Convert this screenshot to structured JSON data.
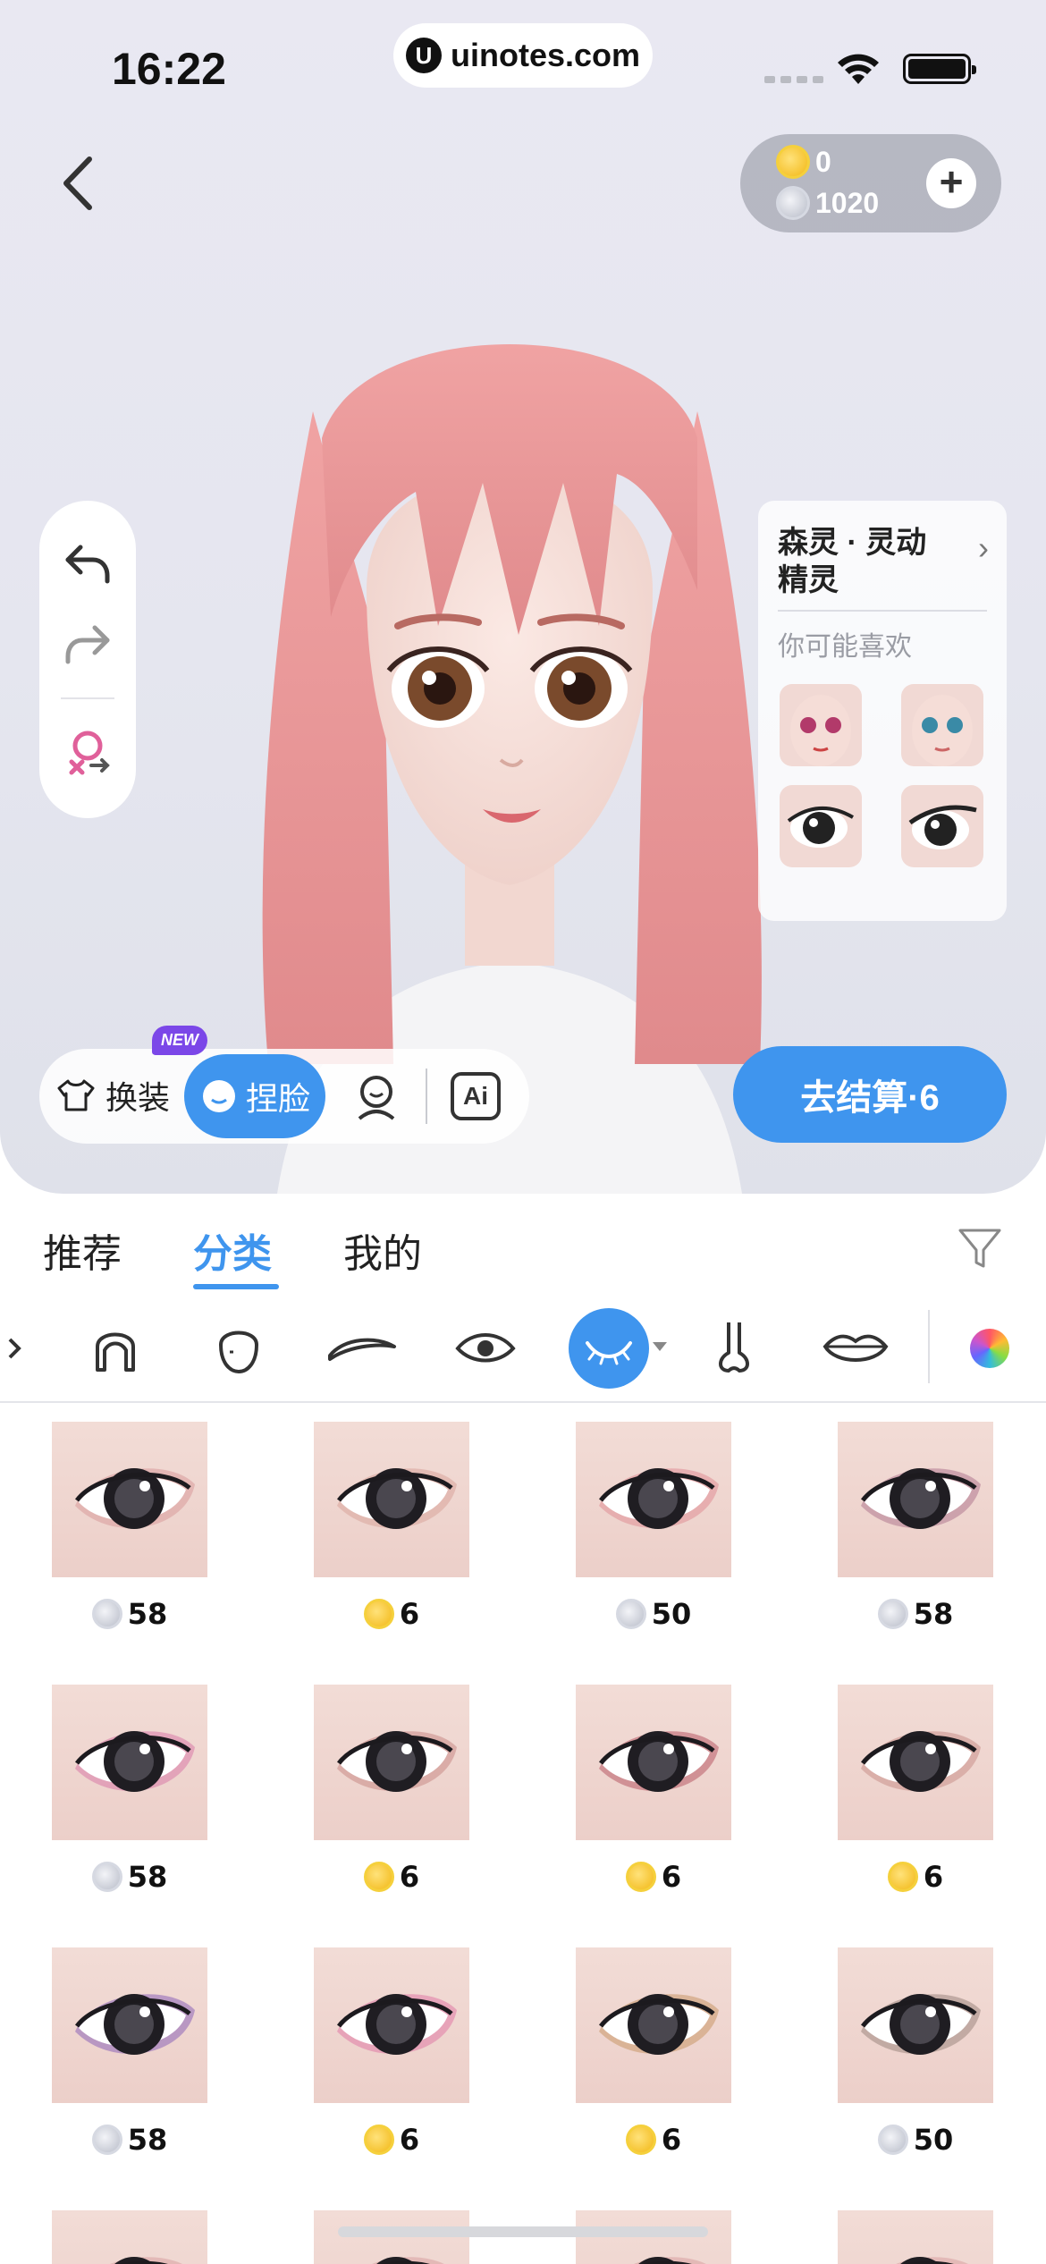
{
  "status_bar": {
    "time": "16:22",
    "url": "uinotes.com"
  },
  "wallet": {
    "gold": "0",
    "silver": "1020",
    "add_label": "+"
  },
  "recommend_card": {
    "title": "森灵 · 灵动精灵",
    "subtitle": "你可能喜欢",
    "chevron": "›"
  },
  "mode_bar": {
    "outfit_label": "换装",
    "face_label": "捏脸",
    "new_badge": "NEW",
    "ai_label": "Ai"
  },
  "checkout": {
    "label": "去结算·6"
  },
  "tabs": [
    {
      "label": "推荐"
    },
    {
      "label": "分类"
    },
    {
      "label": "我的"
    }
  ],
  "categories": [
    "partial-icon",
    "hair-icon",
    "face-shape-icon",
    "eyebrow-icon",
    "eye-icon",
    "eyelash-icon",
    "nose-icon",
    "lips-icon",
    "color-palette-icon"
  ],
  "colors": {
    "accent": "#3f95ee",
    "gold": "#f2b714",
    "silver": "#b8bcc8",
    "new_badge": "#7b47e8"
  },
  "grid_items": [
    {
      "currency": "silver",
      "price": "58",
      "shade": "#d99b9b"
    },
    {
      "currency": "gold",
      "price": "6",
      "shade": "#d9a49b"
    },
    {
      "currency": "silver",
      "price": "50",
      "shade": "#e08e96"
    },
    {
      "currency": "silver",
      "price": "58",
      "shade": "#b07890"
    },
    {
      "currency": "silver",
      "price": "58",
      "shade": "#d87aa8"
    },
    {
      "currency": "gold",
      "price": "6",
      "shade": "#c98a86"
    },
    {
      "currency": "gold",
      "price": "6",
      "shade": "#b85a66"
    },
    {
      "currency": "gold",
      "price": "6",
      "shade": "#c9908a"
    },
    {
      "currency": "silver",
      "price": "58",
      "shade": "#8c64b8"
    },
    {
      "currency": "gold",
      "price": "6",
      "shade": "#e07aa6"
    },
    {
      "currency": "gold",
      "price": "6",
      "shade": "#c99868"
    },
    {
      "currency": "silver",
      "price": "50",
      "shade": "#9c8680"
    }
  ]
}
